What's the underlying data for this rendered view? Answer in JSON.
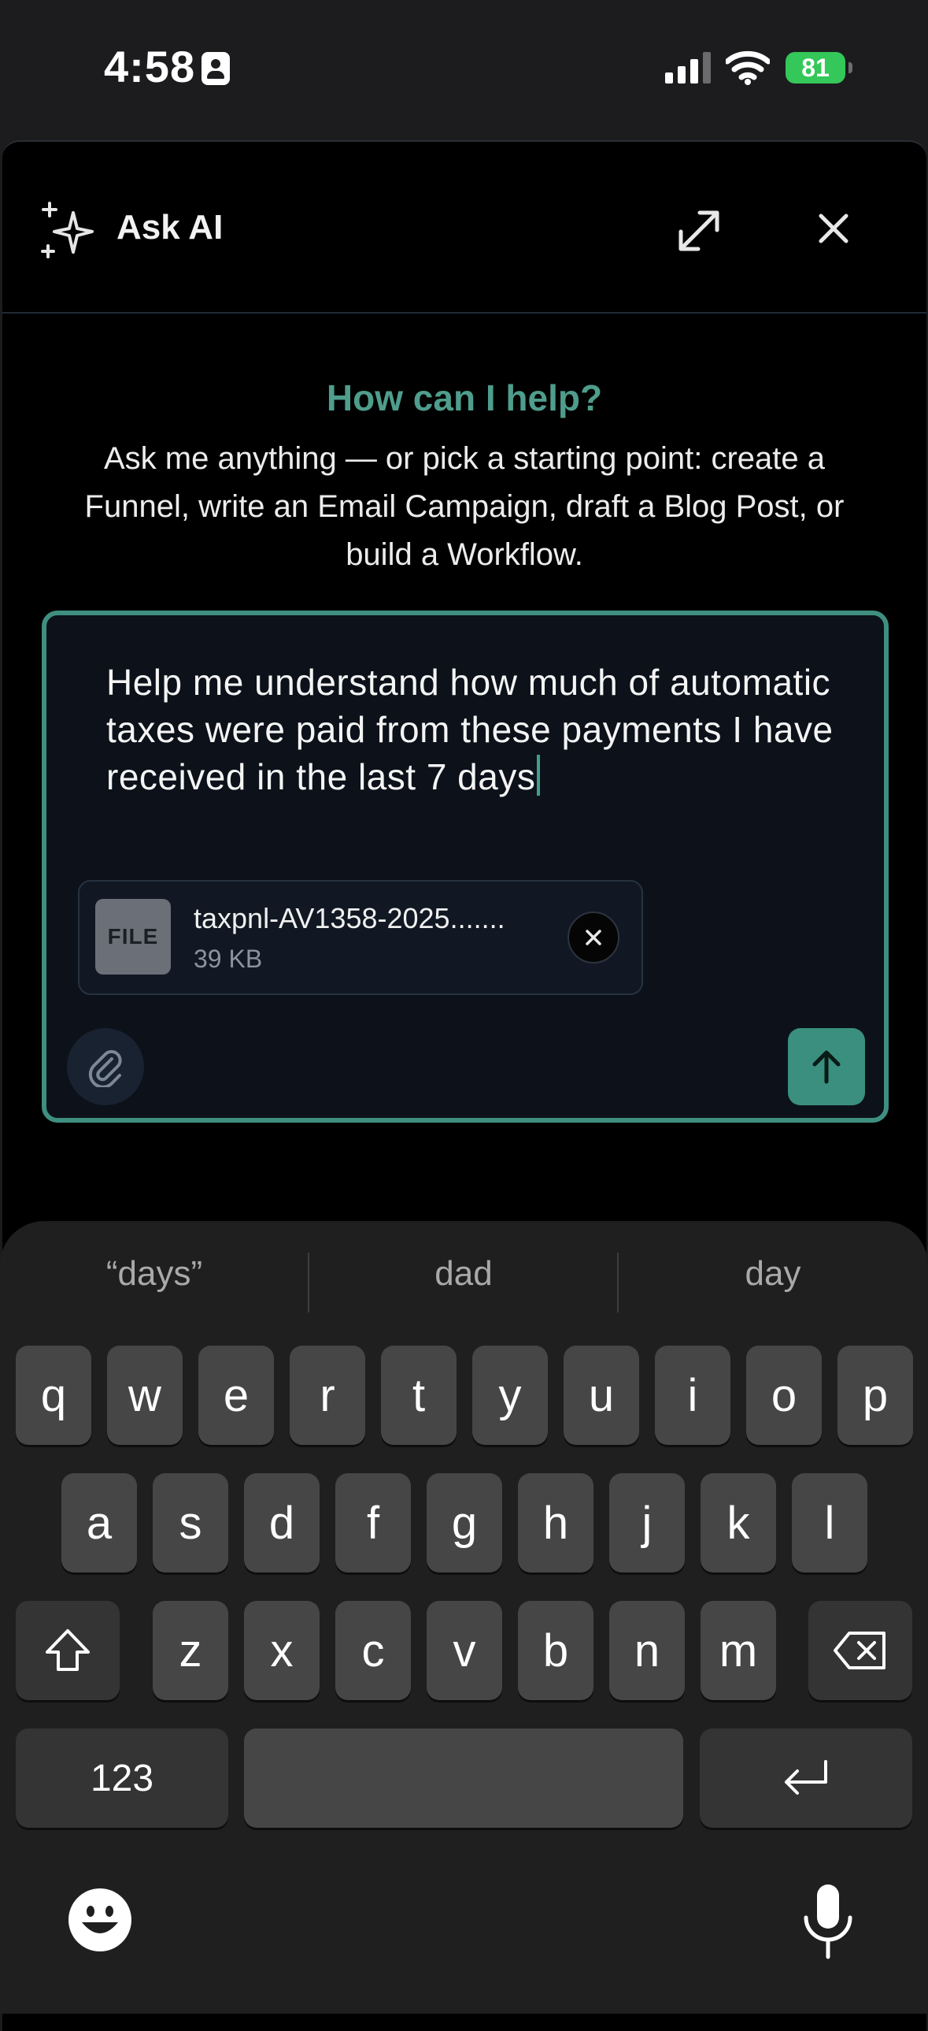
{
  "status_bar": {
    "time": "4:58",
    "battery": "81"
  },
  "header": {
    "title": "Ask AI",
    "icons": [
      "sparkle-icon",
      "expand-icon",
      "close-icon"
    ]
  },
  "intro": {
    "heading": "How can I help?",
    "subtitle": "Ask me anything — or pick a starting point: create a Funnel, write an Email Campaign, draft a Blog Post, or build a Workflow."
  },
  "composer": {
    "prompt_value": "Help me understand how much of automatic taxes were paid from these payments I have received in the last 7 days",
    "attachment": {
      "badge": "FILE",
      "name": "taxpnl-AV1358-2025.......",
      "size": "39 KB"
    },
    "icons": [
      "paperclip-icon",
      "send-arrow-icon"
    ]
  },
  "keyboard": {
    "suggestions": [
      "“days”",
      "dad",
      "day"
    ],
    "row1": [
      "q",
      "w",
      "e",
      "r",
      "t",
      "y",
      "u",
      "i",
      "o",
      "p"
    ],
    "row2": [
      "a",
      "s",
      "d",
      "f",
      "g",
      "h",
      "j",
      "k",
      "l"
    ],
    "row3": [
      "z",
      "x",
      "c",
      "v",
      "b",
      "n",
      "m"
    ],
    "numbers_key": "123",
    "icons": [
      "shift-icon",
      "backspace-icon",
      "return-icon",
      "emoji-icon",
      "microphone-icon"
    ]
  },
  "colors": {
    "accent": "#3a8f7f",
    "heading": "#4f9d8c",
    "battery": "#34c759"
  }
}
